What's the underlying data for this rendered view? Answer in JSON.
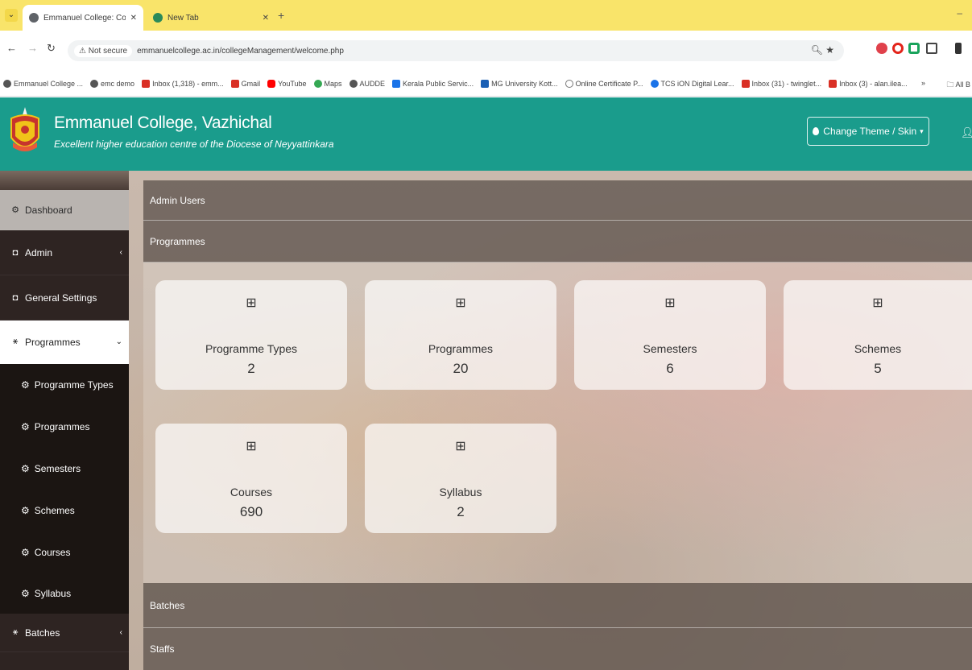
{
  "browser": {
    "tabs": [
      {
        "title": "Emmanuel College: College Ma",
        "active": true
      },
      {
        "title": "New Tab",
        "active": false
      }
    ],
    "security_label": "Not secure",
    "url": "emmanuelcollege.ac.in/collegeManagement/welcome.php",
    "bookmarks": [
      "Emmanuel College ...",
      "emc demo",
      "Inbox (1,318) - emm...",
      "Gmail",
      "YouTube",
      "Maps",
      "AUDDE",
      "Kerala Public Servic...",
      "MG University Kott...",
      "Online Certificate P...",
      "TCS iON Digital Lear...",
      "Inbox (31) - twinglet...",
      "Inbox (3) - alan.ilea..."
    ],
    "bookmarks_more": "»",
    "all_bookmarks": "All B"
  },
  "header": {
    "title": "Emmanuel College, Vazhichal",
    "tagline": "Excellent higher education centre of the Diocese of Neyyattinkara",
    "theme_button": "Change Theme / Skin"
  },
  "sidebar": {
    "items": [
      {
        "label": "Dashboard"
      },
      {
        "label": "Admin"
      },
      {
        "label": "General Settings"
      },
      {
        "label": "Programmes"
      },
      {
        "label": "Programme Types"
      },
      {
        "label": "Programmes"
      },
      {
        "label": "Semesters"
      },
      {
        "label": "Schemes"
      },
      {
        "label": "Courses"
      },
      {
        "label": "Syllabus"
      },
      {
        "label": "Batches"
      }
    ]
  },
  "main": {
    "sections": [
      "Admin Users",
      "Programmes",
      "Batches",
      "Staffs"
    ],
    "cards": [
      {
        "label": "Programme Types",
        "value": "2"
      },
      {
        "label": "Programmes",
        "value": "20"
      },
      {
        "label": "Semesters",
        "value": "6"
      },
      {
        "label": "Schemes",
        "value": "5"
      },
      {
        "label": "Courses",
        "value": "690"
      },
      {
        "label": "Syllabus",
        "value": "2"
      }
    ]
  },
  "colors": {
    "header": "#1a9c8c",
    "sidebar": "#2e2422",
    "tabbar": "#f9e46a"
  }
}
